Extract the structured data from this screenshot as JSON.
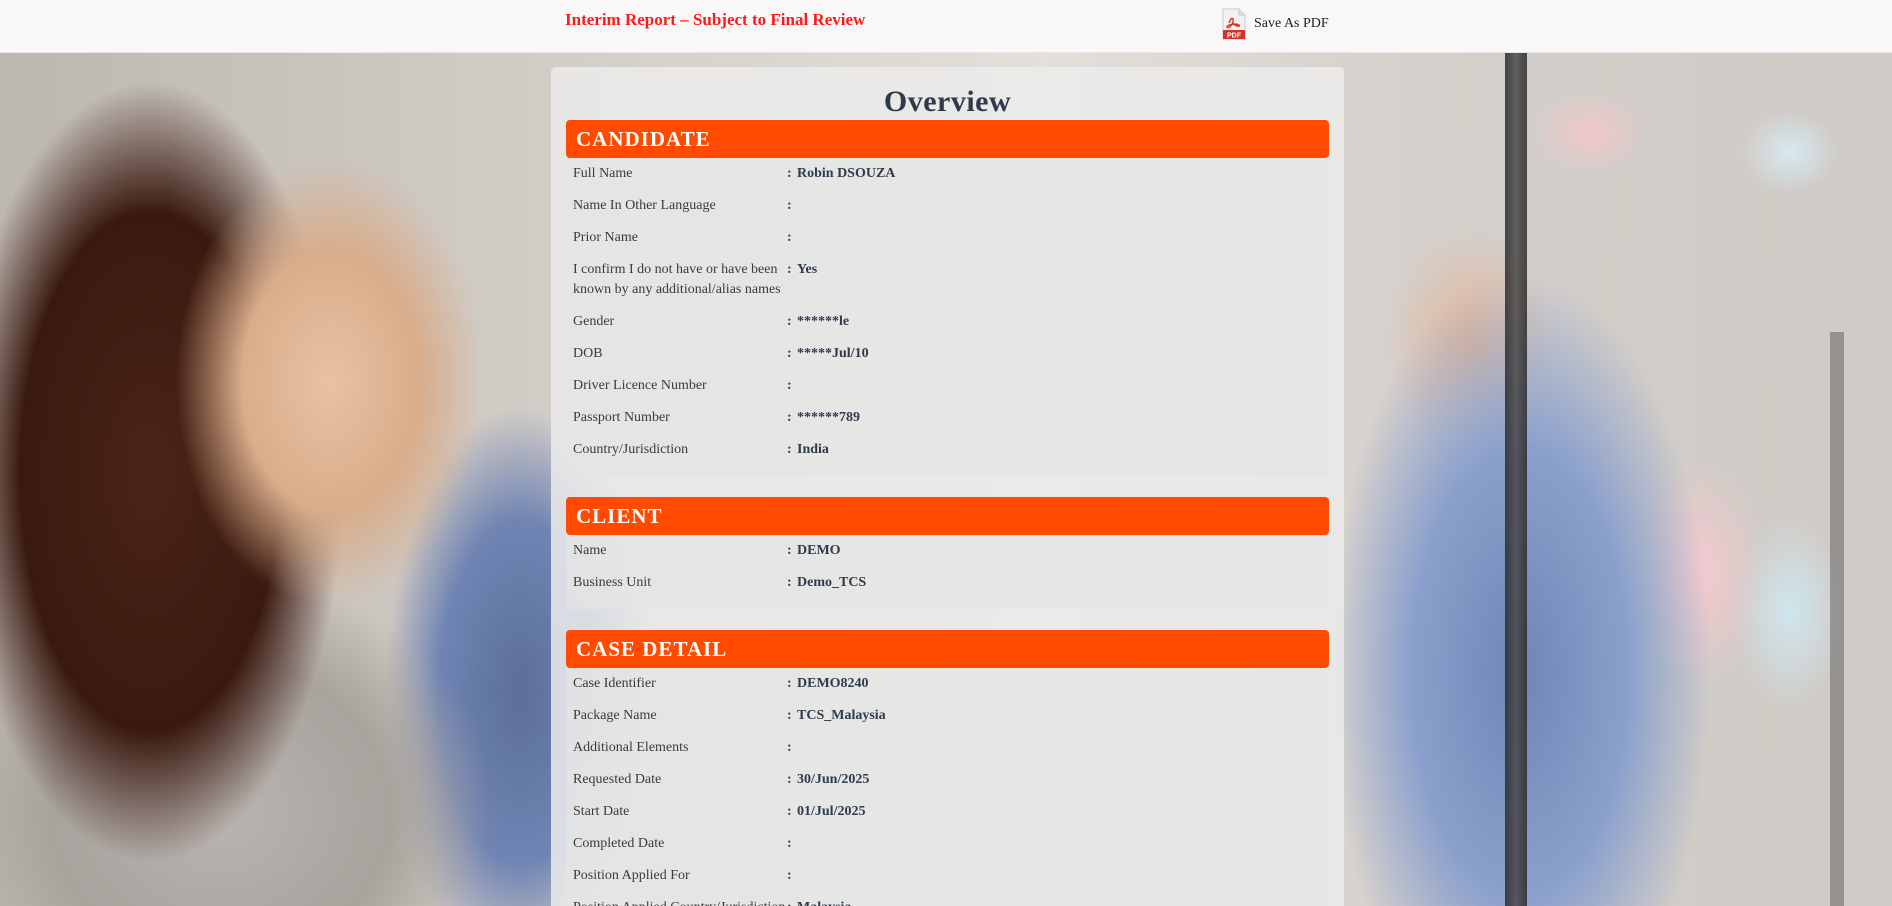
{
  "header": {
    "report_title": "Interim Report – Subject to Final Review",
    "save_pdf_label": "Save As PDF",
    "pdf_icon_text": "PDF"
  },
  "page_title": "Overview",
  "sections": {
    "candidate": {
      "title": "CANDIDATE",
      "rows": [
        {
          "label": "Full Name",
          "value": "Robin DSOUZA"
        },
        {
          "label": "Name In Other Language",
          "value": ""
        },
        {
          "label": "Prior Name",
          "value": ""
        },
        {
          "label": "I confirm I do not have or have been known by any additional/alias names",
          "value": "Yes"
        },
        {
          "label": "Gender",
          "value": "******le"
        },
        {
          "label": "DOB",
          "value": "*****Jul/10"
        },
        {
          "label": "Driver Licence Number",
          "value": ""
        },
        {
          "label": "Passport Number",
          "value": "******789"
        },
        {
          "label": "Country/Jurisdiction",
          "value": "India"
        }
      ]
    },
    "client": {
      "title": "CLIENT",
      "rows": [
        {
          "label": "Name",
          "value": "DEMO"
        },
        {
          "label": "Business Unit",
          "value": "Demo_TCS"
        }
      ]
    },
    "case_detail": {
      "title": "CASE DETAIL",
      "rows": [
        {
          "label": "Case Identifier",
          "value": "DEMO8240"
        },
        {
          "label": "Package Name",
          "value": "TCS_Malaysia"
        },
        {
          "label": "Additional Elements",
          "value": ""
        },
        {
          "label": "Requested Date",
          "value": "30/Jun/2025"
        },
        {
          "label": "Start Date",
          "value": "01/Jul/2025"
        },
        {
          "label": "Completed Date",
          "value": ""
        },
        {
          "label": "Position Applied For",
          "value": ""
        },
        {
          "label": "Position Applied Country/Jurisdiction",
          "value": "Malaysia"
        }
      ]
    }
  },
  "colors": {
    "report_title": "#ff1a1a",
    "section_header_bg": "#ff4a00",
    "overview_title": "#2f3a4b"
  }
}
